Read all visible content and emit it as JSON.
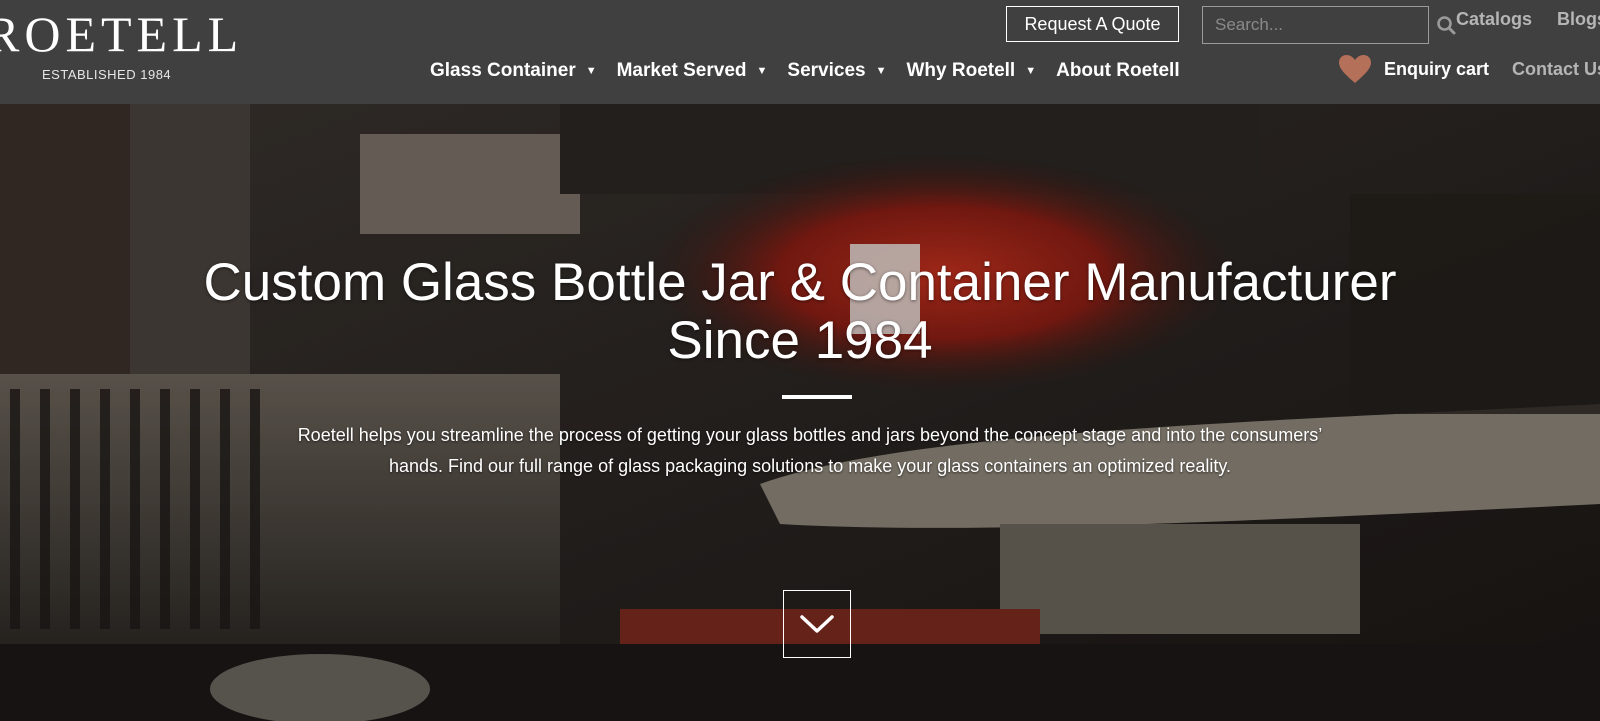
{
  "brand": {
    "logo_text": "ROETELL",
    "tagline": "ESTABLISHED 1984"
  },
  "header": {
    "quote_button": "Request A Quote",
    "search_placeholder": "Search...",
    "top_links": {
      "catalogs": "Catalogs",
      "blogs": "Blogs"
    },
    "nav": [
      {
        "label": "Glass Container",
        "has_dropdown": true
      },
      {
        "label": "Market Served",
        "has_dropdown": true
      },
      {
        "label": "Services",
        "has_dropdown": true
      },
      {
        "label": "Why Roetell",
        "has_dropdown": true
      },
      {
        "label": "About Roetell",
        "has_dropdown": false
      }
    ],
    "enquiry_cart": "Enquiry cart",
    "contact": "Contact Us"
  },
  "hero": {
    "title_line1": "Custom Glass Bottle Jar & Container Manufacturer",
    "title_line2": "Since 1984",
    "text_line1": "Roetell helps you streamline the process of getting your glass bottles and jars beyond the concept stage and into the consumers’",
    "text_line2": "hands. Find our full range of glass packaging solutions to make your glass containers an optimized reality."
  },
  "icons": {
    "search": "search-icon",
    "heart": "heart-icon",
    "caret": "caret-down-icon",
    "scroll": "chevron-down-icon"
  },
  "colors": {
    "header_bg": "#404040",
    "heart": "#b5705a",
    "link_muted": "#b5b5b5"
  }
}
